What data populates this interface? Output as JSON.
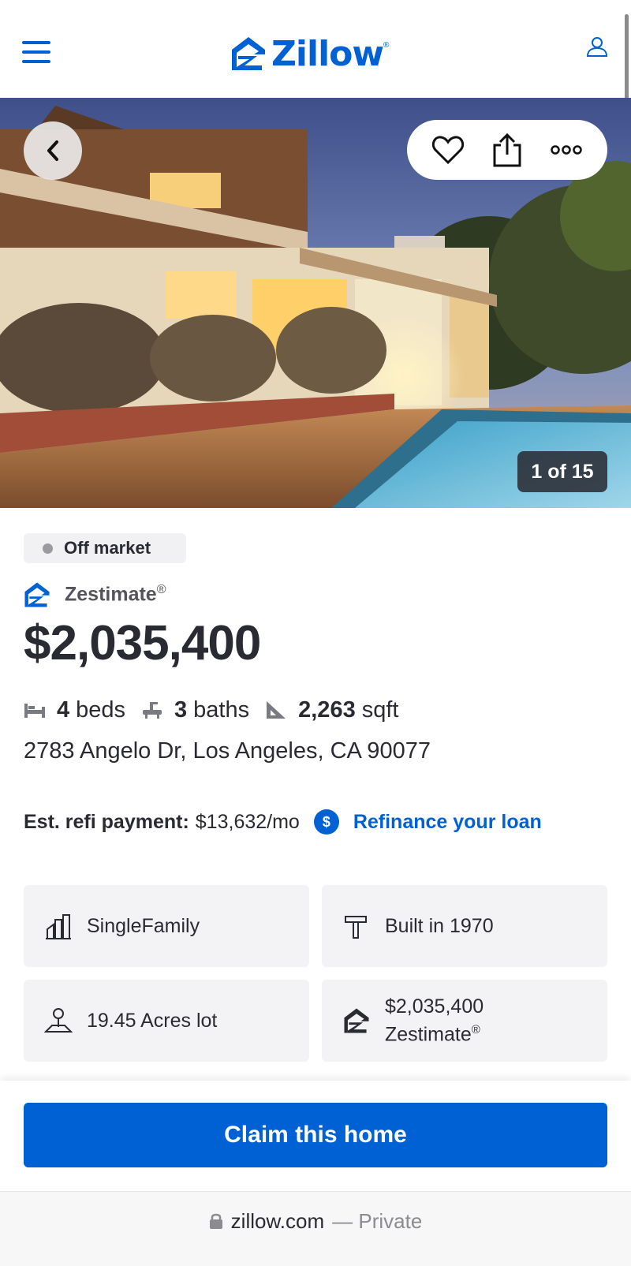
{
  "header": {
    "menu_icon": "hamburger-menu-icon",
    "logo_text": "Zillow",
    "logo_mark": "®",
    "user_icon": "user-icon",
    "brand_color": "#0061d5"
  },
  "hero": {
    "back_icon": "chevron-left-icon",
    "favorite_icon": "heart-icon",
    "share_icon": "share-icon",
    "more_icon": "more-dots-icon",
    "photo_count": "1 of 15"
  },
  "listing": {
    "status": "Off market",
    "zestimate_label": "Zestimate",
    "zestimate_reg": "®",
    "price": "$2,035,400",
    "beds_num": "4",
    "beds_label": "beds",
    "baths_num": "3",
    "baths_label": "baths",
    "sqft_num": "2,263",
    "sqft_label": "sqft",
    "address": "2783 Angelo Dr, Los Angeles, CA 90077"
  },
  "refi": {
    "label": "Est. refi payment:",
    "value": "$13,632/mo",
    "dollar_icon": "$",
    "link": "Refinance your loan"
  },
  "facts": {
    "type": "SingleFamily",
    "built": "Built in 1970",
    "lot": "19.45 Acres lot",
    "zestimate_value": "$2,035,400",
    "zestimate_label": "Zestimate",
    "zestimate_reg": "®"
  },
  "cta": {
    "claim_label": "Claim this home"
  },
  "browser": {
    "domain": "zillow.com",
    "private_label": "— Private"
  }
}
